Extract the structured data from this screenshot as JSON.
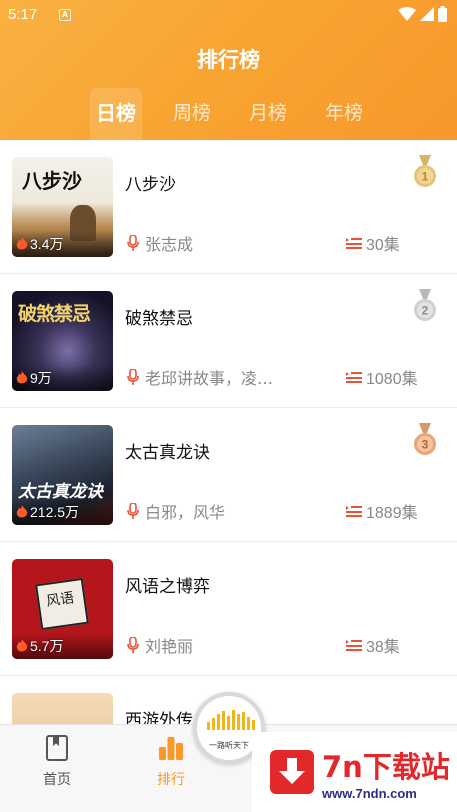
{
  "status_bar": {
    "time": "5:17",
    "notification_badge": "A"
  },
  "header": {
    "title": "排行榜"
  },
  "tabs": [
    {
      "label": "日榜",
      "active": true
    },
    {
      "label": "周榜",
      "active": false
    },
    {
      "label": "月榜",
      "active": false
    },
    {
      "label": "年榜",
      "active": false
    }
  ],
  "books": [
    {
      "rank": "1",
      "title": "八步沙",
      "plays": "3.4万",
      "author": "张志成",
      "episodes": "30集",
      "cover_text": "八步沙",
      "medal": "gold"
    },
    {
      "rank": "2",
      "title": "破煞禁忌",
      "plays": "9万",
      "author": "老邱讲故事，凌…",
      "episodes": "1080集",
      "cover_text": "破煞禁忌",
      "medal": "silver"
    },
    {
      "rank": "3",
      "title": "太古真龙诀",
      "plays": "212.5万",
      "author": "白邪，风华",
      "episodes": "1889集",
      "cover_text": "太古真龙诀",
      "medal": "bronze"
    },
    {
      "rank": "",
      "title": "风语之博弈",
      "plays": "5.7万",
      "author": "刘艳丽",
      "episodes": "38集",
      "cover_text": "风语",
      "medal": ""
    },
    {
      "rank": "",
      "title": "西游外传",
      "plays": "",
      "author": "",
      "episodes": "",
      "cover_text": "",
      "medal": ""
    }
  ],
  "bottom_nav": {
    "home_label": "首页",
    "rank_label": "排行"
  },
  "player": {
    "text": "一路听天下"
  },
  "watermark": {
    "title": "7n下载站",
    "url": "www.7ndn.com"
  },
  "colors": {
    "accent": "#f79a2b",
    "header_start": "#f9b142",
    "header_end": "#f7972a",
    "icon_red": "#e8533a"
  }
}
